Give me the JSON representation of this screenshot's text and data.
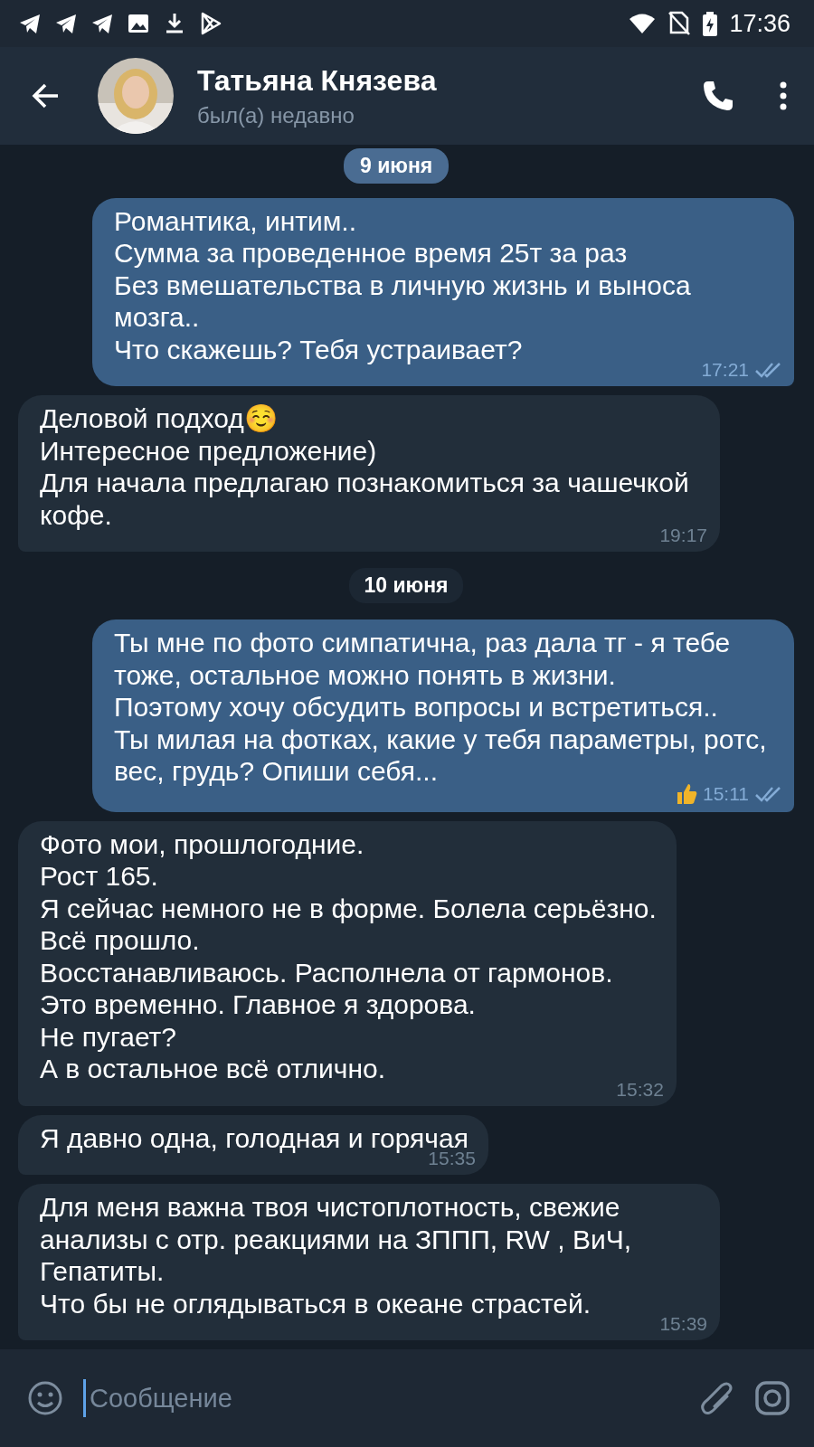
{
  "status_bar": {
    "time": "17:36"
  },
  "header": {
    "name": "Татьяна Князева",
    "status": "был(а) недавно"
  },
  "floating_date": "9 июня",
  "messages": [
    {
      "kind": "message",
      "outgoing": true,
      "text": "Романтика, интим..\nСумма за проведенное время 25т за раз\nБез вмешательства в личную жизнь и выноса мозга..\nЧто скажешь? Тебя устраивает?",
      "time": "17:21",
      "read": true
    },
    {
      "kind": "message",
      "outgoing": false,
      "text": "Деловой подход☺️\nИнтересное предложение)\nДля начала предлагаю познакомиться за чашечкой кофе.",
      "time": "19:17"
    },
    {
      "kind": "date",
      "text": "10 июня"
    },
    {
      "kind": "message",
      "outgoing": true,
      "text": "Ты мне по фото симпатична, раз дала тг - я тебе тоже, остальное можно понять в жизни.\nПоэтому хочу обсудить вопросы и встретиться..\nТы милая на фотках, какие у тебя параметры, ротс, вес, грудь? Опиши себя...",
      "time": "15:11",
      "read": true,
      "liked": true
    },
    {
      "kind": "message",
      "outgoing": false,
      "text": "Фото мои, прошлогодние.\nРост 165.\nЯ сейчас немного не в форме. Болела серьёзно.\nВсё прошло.\nВосстанавливаюсь. Располнела от гармонов.\nЭто временно. Главное я здорова.\nНе пугает?\nА в остальное всё отлично.",
      "time": "15:32"
    },
    {
      "kind": "message",
      "outgoing": false,
      "text": "Я давно одна, голодная и горячая",
      "time": "15:35"
    },
    {
      "kind": "message",
      "outgoing": false,
      "text": "Для меня важна твоя чистоплотность, свежие анализы с отр. реакциями на ЗППП, RW , ВиЧ, Гепатиты.\nЧто бы не оглядываться в океане страстей.",
      "time": "15:39"
    }
  ],
  "composer": {
    "placeholder": "Сообщение"
  }
}
